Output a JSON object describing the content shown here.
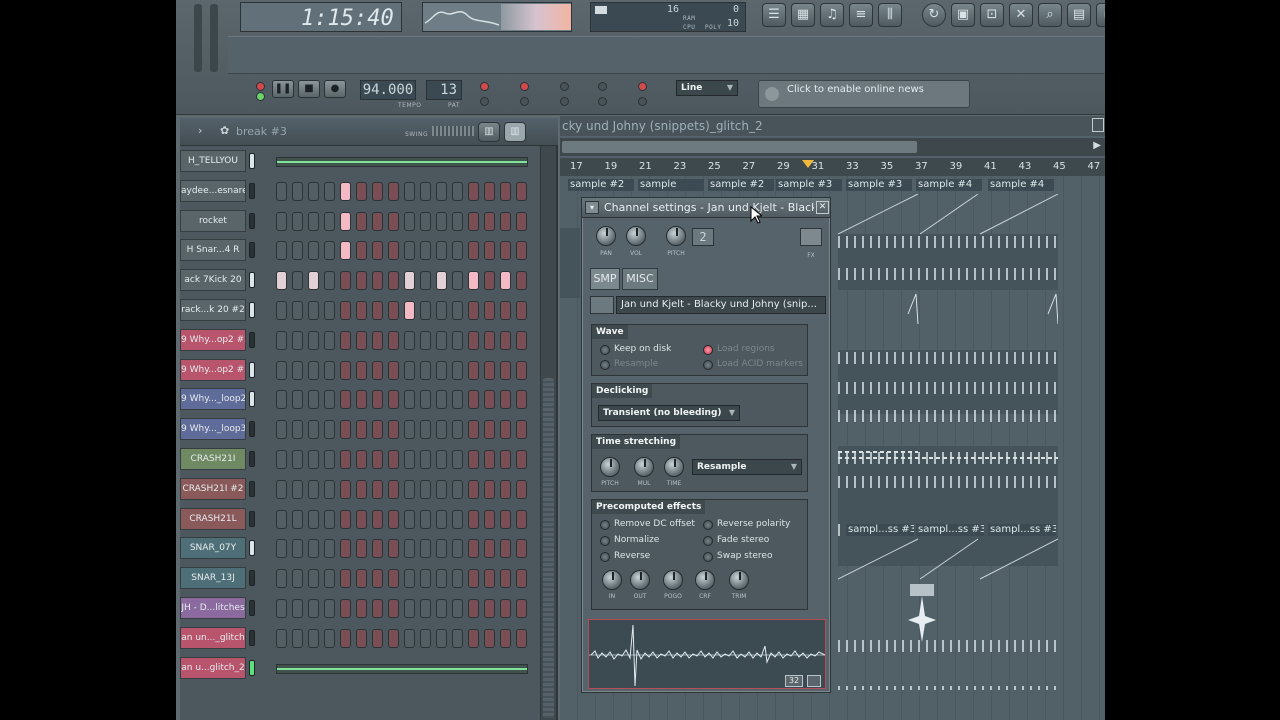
{
  "toolbar": {
    "time": "1:15:40",
    "tempo": "94.000",
    "pattern_num": "13",
    "snap": "Line",
    "news": "Click to enable online news",
    "tempo_label": "TEMPO",
    "pat_label": "PAT",
    "cpu_values": [
      "16",
      "0",
      "10"
    ],
    "cpu_labels": [
      "RAM",
      "CPU",
      "POLY"
    ]
  },
  "sequencer": {
    "title": "break #3",
    "swing_label": "SWING",
    "channels": [
      {
        "name": "H_TELLYOU",
        "type": "bar",
        "color": "#5a656a",
        "led": "on"
      },
      {
        "name": "aydee...esnare",
        "color": "#5a656a",
        "led": "off",
        "steps": "....L..........."
      },
      {
        "name": "rocket",
        "color": "#5a656a",
        "led": "off",
        "steps": "....L..........."
      },
      {
        "name": "H Snar...4   R",
        "color": "#5a656a",
        "led": "off",
        "steps": "....L..........."
      },
      {
        "name": "ack  7Kick 20",
        "color": "#5a656a",
        "led": "on",
        "steps": "W.W.....W.W.L.L."
      },
      {
        "name": "rack...k 20 #2",
        "color": "#5a656a",
        "led": "on",
        "steps": "........L......."
      },
      {
        "name": "9 Why...op2 #2",
        "color": "#b8546c",
        "led": "off",
        "steps": "................"
      },
      {
        "name": "9 Why...op2 #3",
        "color": "#b8546c",
        "led": "on",
        "steps": "................"
      },
      {
        "name": "9 Why..._loop2",
        "color": "#5f6c99",
        "led": "on",
        "steps": "................"
      },
      {
        "name": "9 Why..._loop3",
        "color": "#5f6c99",
        "led": "off",
        "steps": "................"
      },
      {
        "name": "CRASH21I",
        "color": "#6f8a62",
        "led": "off",
        "steps": "................"
      },
      {
        "name": "CRASH21I #2",
        "color": "#8a5a5a",
        "led": "off",
        "steps": "................"
      },
      {
        "name": "CRASH21L",
        "color": "#8a5a5a",
        "led": "off",
        "steps": "................"
      },
      {
        "name": "SNAR_07Y",
        "color": "#4f6f78",
        "led": "on",
        "steps": "................"
      },
      {
        "name": "SNAR_13J",
        "color": "#4f6f78",
        "led": "off",
        "steps": "................"
      },
      {
        "name": "JH - D...litches",
        "color": "#8b6aa0",
        "led": "off",
        "steps": "................"
      },
      {
        "name": "an un..._glitch",
        "color": "#b8546c",
        "led": "off",
        "steps": "................"
      },
      {
        "name": "an u...glitch_2",
        "color": "#b8546c",
        "type": "bar",
        "led": "green"
      }
    ]
  },
  "playlist": {
    "title": "cky und Johny (snippets)_glitch_2",
    "bar_numbers": [
      "17",
      "19",
      "21",
      "23",
      "25",
      "27",
      "29",
      "31",
      "33",
      "35",
      "37",
      "39",
      "41",
      "43",
      "45",
      "47"
    ],
    "clips_row1": [
      "sample #2",
      "sample",
      "sample #2",
      "sample #3",
      "sample #3",
      "sample #4",
      "sample #4"
    ],
    "clips_row2": [
      "sampl...ss #3",
      "sampl...ss #3",
      "sampl...ss #3"
    ]
  },
  "channel_window": {
    "title": "Channel settings - Jan und Kjelt - Blacky...",
    "knobs": [
      "PAN",
      "VOL",
      "PITCH"
    ],
    "fx_label": "FX",
    "channel_num": "2",
    "tabs": [
      "SMP",
      "MISC"
    ],
    "sample_name": "Jan und Kjelt - Blacky und Johny (snip...",
    "wave": {
      "title": "Wave",
      "options": [
        {
          "label": "Keep on disk",
          "on": false,
          "dim": false
        },
        {
          "label": "Resample",
          "on": false,
          "dim": true
        },
        {
          "label": "Load regions",
          "on": true,
          "dim": true
        },
        {
          "label": "Load ACID markers",
          "on": false,
          "dim": true
        }
      ]
    },
    "declicking": {
      "title": "Declicking",
      "value": "Transient (no bleeding)"
    },
    "time_stretching": {
      "title": "Time stretching",
      "knobs": [
        "PITCH",
        "MUL",
        "TIME"
      ],
      "mode": "Resample"
    },
    "precomputed": {
      "title": "Precomputed effects",
      "options": [
        "Remove DC offset",
        "Normalize",
        "Reverse",
        "Reverse polarity",
        "Fade stereo",
        "Swap stereo"
      ],
      "knobs": [
        "IN",
        "OUT",
        "POGO",
        "CRF",
        "TRIM"
      ]
    },
    "wave_zoom": "32"
  }
}
